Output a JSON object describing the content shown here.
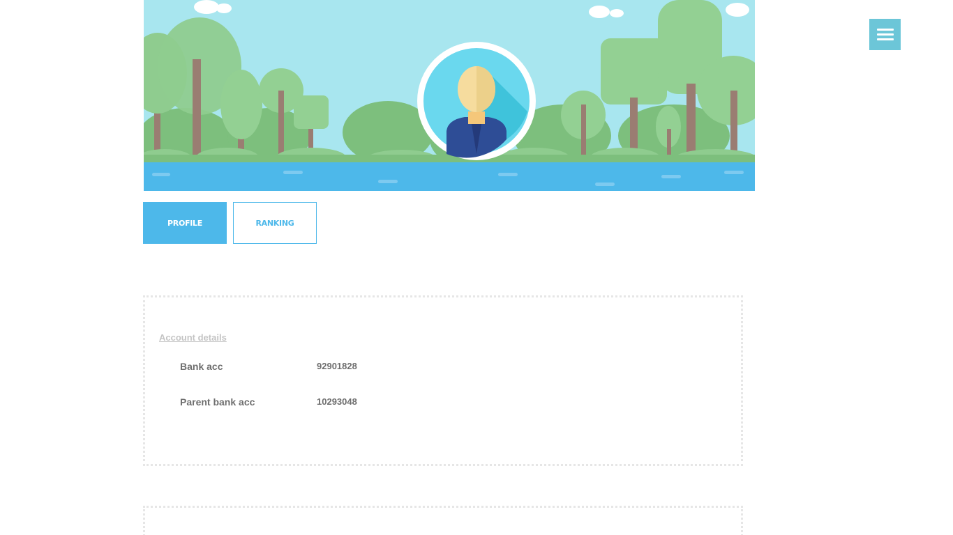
{
  "header": {
    "menu_icon": "hamburger-menu-icon",
    "avatar_icon": "user-avatar-icon"
  },
  "tabs": [
    {
      "label": "PROFILE",
      "active": true
    },
    {
      "label": "RANKING",
      "active": false
    }
  ],
  "account": {
    "title": "Account details",
    "rows": [
      {
        "label": "Bank acc",
        "value": "92901828"
      },
      {
        "label": "Parent bank acc",
        "value": "10293048"
      }
    ]
  },
  "colors": {
    "accent": "#4db8ea",
    "menu": "#6cc6d8",
    "sky": "#a8e6ef",
    "water": "#4db8ea",
    "tree_green": "#8fcc8f",
    "trunk": "#9a7d72"
  }
}
